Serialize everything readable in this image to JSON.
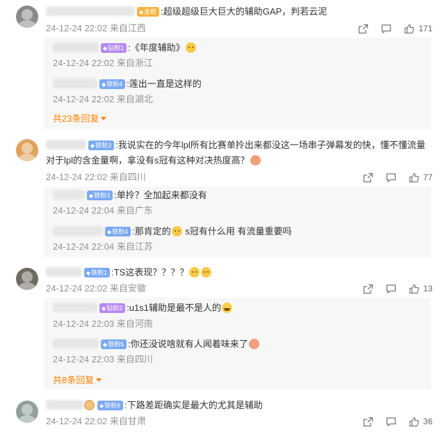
{
  "comments": [
    {
      "id": "c1",
      "badge": {
        "text": "金粉",
        "color": "#f4b43e"
      },
      "text": ":超级超级巨大巨大的辅助GAP，判若云泥",
      "time": "24-12-24 22:02",
      "location": "来自江西",
      "likes": "171",
      "replies": [
        {
          "badge": {
            "text": "钻粉1",
            "color": "#b789f3"
          },
          "text": ":《年度辅助》",
          "emoji": "cat-emoji",
          "time": "24-12-24 22:02",
          "location": "来自浙江"
        },
        {
          "badge": {
            "text": "铁粉4",
            "color": "#7aa9f2"
          },
          "text": ":莲出一直是这样的",
          "time": "24-12-24 22:02",
          "location": "来自湖北"
        }
      ],
      "more": "共23条回复"
    },
    {
      "id": "c2",
      "badge": {
        "text": "铁粉3",
        "color": "#7aa9f2"
      },
      "text": ":我说实在的今年lpl所有比赛单拎出来都没这一场串子弹幕发的快，懂不懂流量对于lpl的含金量啊，拿没有s冠有这种对决热度高？",
      "time": "24-12-24 22:02",
      "location": "来自四川",
      "likes": "77",
      "replies": [
        {
          "badge": {
            "text": "铁粉3",
            "color": "#7aa9f2"
          },
          "text": ":单拎？全加起来都没有",
          "time": "24-12-24 22:04",
          "location": "来自广东"
        },
        {
          "badge": {
            "text": "铁粉4",
            "color": "#7aa9f2"
          },
          "text_a": ":那肯定的",
          "text_b": " s冠有什么用 有流量重要吗",
          "time": "24-12-24 22:04",
          "location": "来自江苏"
        }
      ]
    },
    {
      "id": "c3",
      "badge": {
        "text": "铁粉1",
        "color": "#7aa9f2"
      },
      "text": ":TS这表现？？？？",
      "time": "24-12-24 22:02",
      "location": "来自安徽",
      "likes": "13",
      "replies": [
        {
          "badge": {
            "text": "钻粉2",
            "color": "#b789f3"
          },
          "text": ":u1s1辅助是最不是人的",
          "time": "24-12-24 22:03",
          "location": "来自河南"
        },
        {
          "badge": {
            "text": "铁粉5",
            "color": "#7aa9f2"
          },
          "text": ":你还没说啥就有人闻着味来了",
          "time": "24-12-24 22:03",
          "location": "来自四川"
        }
      ],
      "more": "共8条回复"
    },
    {
      "id": "c4",
      "badge": {
        "text": "铁粉8",
        "color": "#7aa9f2"
      },
      "text": ":下路差距确实是最大的尤其是辅助",
      "time": "24-12-24 22:02",
      "location": "来自甘肃",
      "likes": "36"
    }
  ],
  "icons": {
    "share": "share-icon",
    "comment": "comment-icon",
    "like": "thumbs-up-icon",
    "badge_prefix": "diamond-icon"
  }
}
